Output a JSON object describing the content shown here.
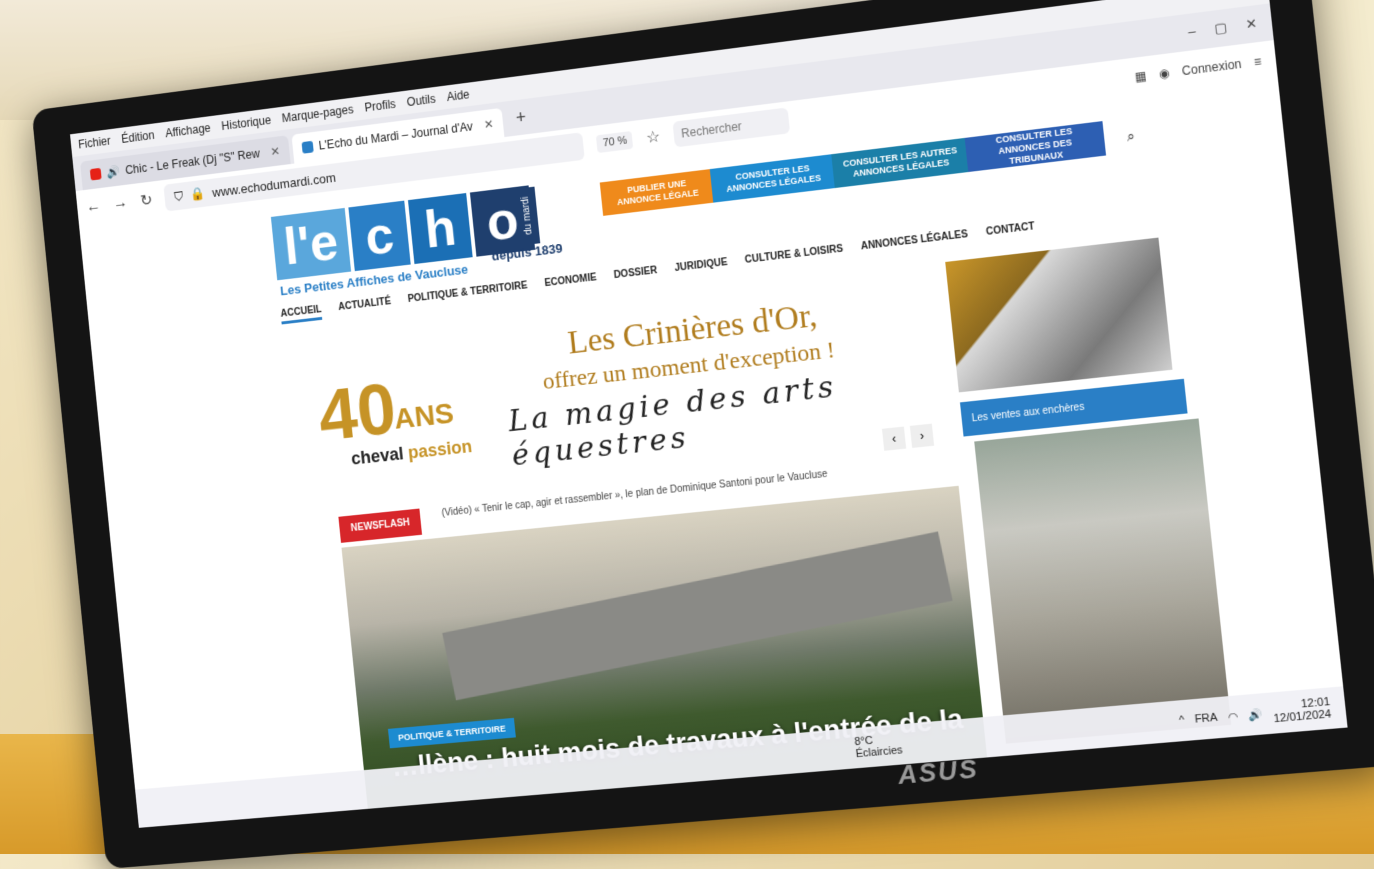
{
  "menubar": [
    "Fichier",
    "Édition",
    "Affichage",
    "Historique",
    "Marque-pages",
    "Profils",
    "Outils",
    "Aide"
  ],
  "tabs": [
    {
      "label": "Chic - Le Freak (Dj \"S\" Rew",
      "active": false
    },
    {
      "label": "L'Echo du Mardi – Journal d'Av",
      "active": true
    }
  ],
  "navbar": {
    "url": "www.echodumardi.com",
    "zoom": "70 %",
    "search_placeholder": "Rechercher",
    "account": "Connexion"
  },
  "logo": {
    "letters": [
      "l'e",
      "c",
      "h",
      "o"
    ],
    "vertical": "du mardi",
    "since": "depuis 1839",
    "subtitle": "Les Petites Affiches de Vaucluse"
  },
  "ctas": [
    "PUBLIER UNE ANNONCE LÉGALE",
    "CONSULTER LES ANNONCES LÉGALES",
    "CONSULTER LES AUTRES ANNONCES LÉGALES",
    "CONSULTER LES ANNONCES DES TRIBUNAUX"
  ],
  "mainnav": [
    "ACCUEIL",
    "ACTUALITÉ",
    "POLITIQUE & TERRITOIRE",
    "ECONOMIE",
    "DOSSIER",
    "JURIDIQUE",
    "CULTURE & LOISIRS",
    "ANNONCES LÉGALES",
    "CONTACT"
  ],
  "banner": {
    "number": "40",
    "ans": "ANS",
    "brand1": "cheval",
    "brand2": "passion",
    "title": "Les Crinières d'Or,",
    "subtitle": "offrez un moment d'exception !",
    "script": "La magie des arts équestres"
  },
  "sidebar": {
    "bar": "Les ventes aux enchères"
  },
  "newsflash": {
    "label": "NEWSFLASH",
    "ticker": "(Vidéo) « Tenir le cap, agir et rassembler », le plan de Dominique Santoni pour le Vaucluse"
  },
  "hero": {
    "tag": "POLITIQUE & TERRITOIRE",
    "title": "…llène : huit mois de travaux à l'entrée de la"
  },
  "taskbar": {
    "temp": "8°C",
    "weather": "Éclaircies",
    "lang": "FRA",
    "time": "12:01",
    "date": "12/01/2024"
  },
  "monitor": {
    "brand": "ASUS"
  },
  "colors": {
    "orange": "#ef8a1b",
    "blue": "#1d8bd0",
    "red": "#d7262a",
    "gold": "#c69326"
  }
}
